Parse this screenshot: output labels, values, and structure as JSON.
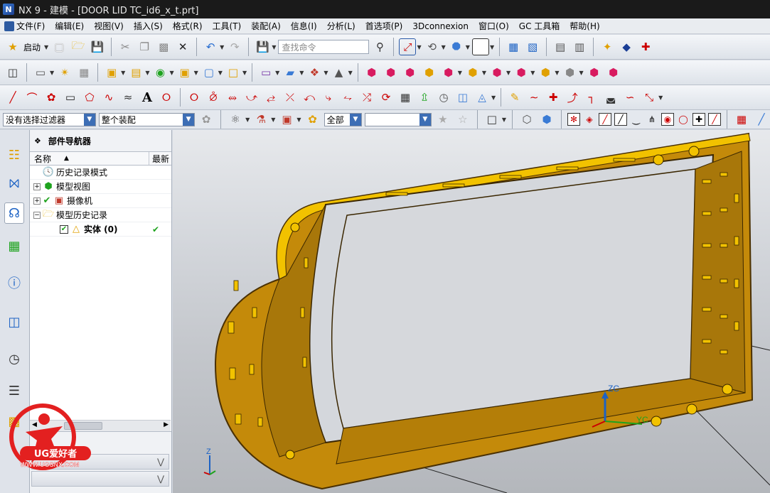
{
  "window": {
    "title": "NX 9 - 建模 - [DOOR LID TC_id6_x_t.prt]"
  },
  "menu": [
    "文件(F)",
    "编辑(E)",
    "视图(V)",
    "插入(S)",
    "格式(R)",
    "工具(T)",
    "装配(A)",
    "信息(I)",
    "分析(L)",
    "首选项(P)",
    "3Dconnexion",
    "窗口(O)",
    "GC 工具箱",
    "帮助(H)"
  ],
  "toolbar": {
    "start_label": "启动",
    "search_placeholder": "查找命令"
  },
  "filterbar": {
    "filter_value": "没有选择过滤器",
    "scope_value": "整个装配",
    "range_value": "全部",
    "extra_value": ""
  },
  "navigator": {
    "title": "部件导航器",
    "col_name": "名称",
    "col_latest": "最新",
    "items": [
      {
        "label": "历史记录模式",
        "icon": "clock-icon"
      },
      {
        "label": "模型视图",
        "icon": "cube-views-icon"
      },
      {
        "label": "摄像机",
        "icon": "camera-icon"
      },
      {
        "label": "模型历史记录",
        "icon": "folder-icon"
      },
      {
        "label": "实体 (0)",
        "icon": "solid-body-icon"
      }
    ]
  },
  "viewport": {
    "axis_zc": "ZC",
    "axis_yc": "YC",
    "axis_z": "Z"
  },
  "watermark": {
    "brand": "UG爱好者",
    "site": "WWW.UGSNX.COM"
  },
  "colors": {
    "model_fill": "#c48a0a",
    "model_highlight": "#f2c200",
    "model_edge": "#4a3000",
    "accent": "#3d6eb5"
  }
}
